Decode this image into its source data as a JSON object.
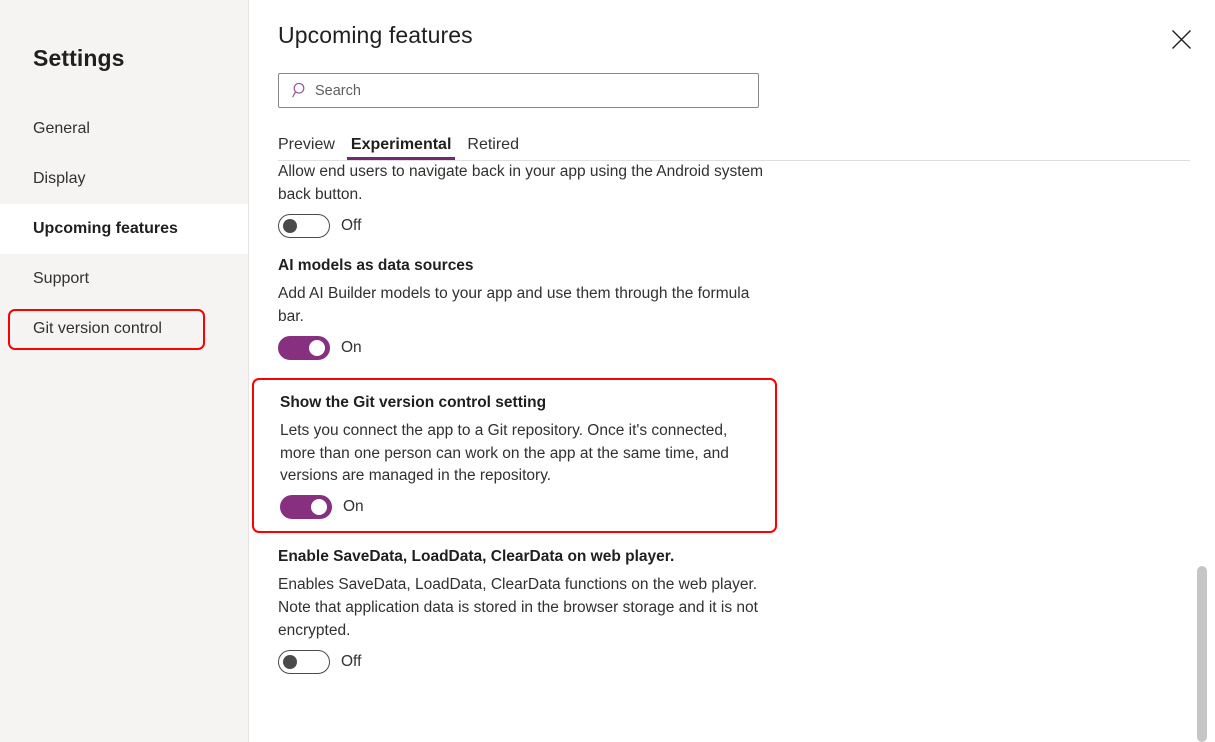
{
  "sidebar": {
    "title": "Settings",
    "items": [
      {
        "label": "General",
        "selected": false
      },
      {
        "label": "Display",
        "selected": false
      },
      {
        "label": "Upcoming features",
        "selected": true
      },
      {
        "label": "Support",
        "selected": false
      },
      {
        "label": "Git version control",
        "selected": false,
        "annotated": true
      }
    ]
  },
  "header": {
    "title": "Upcoming features",
    "close_icon": "close-icon"
  },
  "search": {
    "placeholder": "Search",
    "value": "",
    "icon": "search-icon"
  },
  "tabs": [
    {
      "label": "Preview",
      "active": false
    },
    {
      "label": "Experimental",
      "active": true
    },
    {
      "label": "Retired",
      "active": false
    }
  ],
  "features": [
    {
      "title": "",
      "description": "Allow end users to navigate back in your app using the Android system back button.",
      "toggle_state": "Off",
      "toggle_on": false,
      "annotated": false
    },
    {
      "title": "AI models as data sources",
      "description": "Add AI Builder models to your app and use them through the formula bar.",
      "toggle_state": "On",
      "toggle_on": true,
      "annotated": false
    },
    {
      "title": "Show the Git version control setting",
      "description": "Lets you connect the app to a Git repository. Once it's connected, more than one person can work on the app at the same time, and versions are managed in the repository.",
      "toggle_state": "On",
      "toggle_on": true,
      "annotated": true
    },
    {
      "title": "Enable SaveData, LoadData, ClearData on web player.",
      "description": "Enables SaveData, LoadData, ClearData functions on the web player. Note that application data is stored in the browser storage and it is not encrypted.",
      "toggle_state": "Off",
      "toggle_on": false,
      "annotated": false
    }
  ],
  "colors": {
    "accent_purple": "#742774",
    "toggle_on": "#87307f",
    "annotation_red": "#ff0000",
    "sidebar_bg": "#f5f4f2",
    "scrollbar_thumb": "#c8c6c4"
  }
}
